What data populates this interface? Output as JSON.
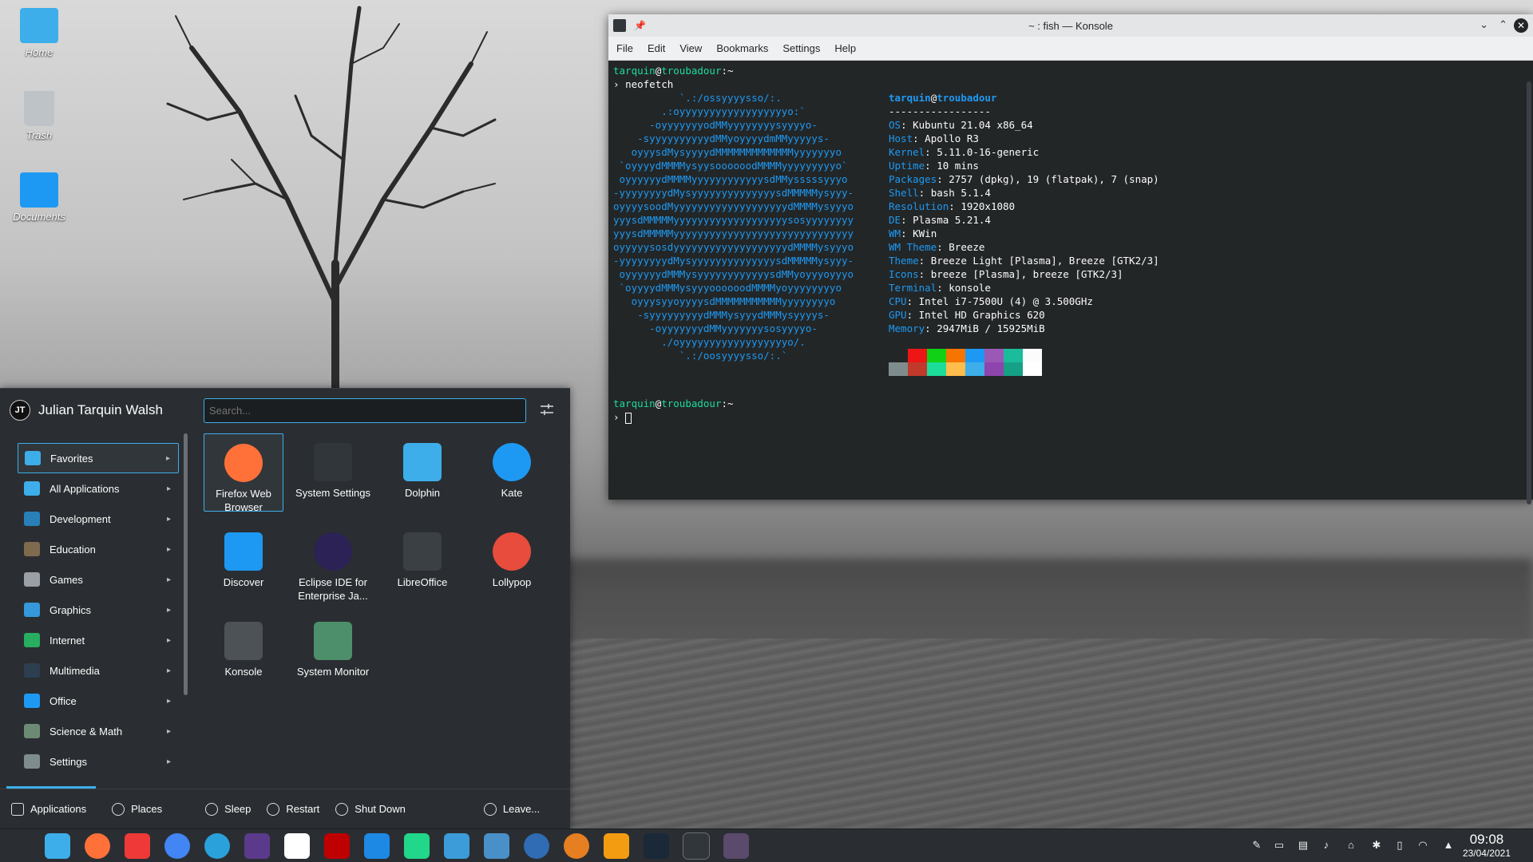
{
  "desktop": {
    "icons": [
      {
        "label": "Home"
      },
      {
        "label": "Trash"
      },
      {
        "label": "Documents"
      }
    ]
  },
  "konsole": {
    "title": "~ : fish — Konsole",
    "menu": [
      "File",
      "Edit",
      "View",
      "Bookmarks",
      "Settings",
      "Help"
    ],
    "prompt_user": "tarquin",
    "prompt_host": "troubadour",
    "prompt_path": "~",
    "command": "neofetch",
    "info_header_user": "tarquin",
    "info_header_host": "troubadour",
    "info_separator": "-----------------",
    "info": [
      {
        "key": "OS",
        "value": "Kubuntu 21.04 x86_64"
      },
      {
        "key": "Host",
        "value": "Apollo R3"
      },
      {
        "key": "Kernel",
        "value": "5.11.0-16-generic"
      },
      {
        "key": "Uptime",
        "value": "10 mins"
      },
      {
        "key": "Packages",
        "value": "2757 (dpkg), 19 (flatpak), 7 (snap)"
      },
      {
        "key": "Shell",
        "value": "bash 5.1.4"
      },
      {
        "key": "Resolution",
        "value": "1920x1080"
      },
      {
        "key": "DE",
        "value": "Plasma 5.21.4"
      },
      {
        "key": "WM",
        "value": "KWin"
      },
      {
        "key": "WM Theme",
        "value": "Breeze"
      },
      {
        "key": "Theme",
        "value": "Breeze Light [Plasma], Breeze [GTK2/3]"
      },
      {
        "key": "Icons",
        "value": "breeze [Plasma], breeze [GTK2/3]"
      },
      {
        "key": "Terminal",
        "value": "konsole"
      },
      {
        "key": "CPU",
        "value": "Intel i7-7500U (4) @ 3.500GHz"
      },
      {
        "key": "GPU",
        "value": "Intel HD Graphics 620"
      },
      {
        "key": "Memory",
        "value": "2947MiB / 15925MiB"
      }
    ],
    "palette_top": [
      "#232627",
      "#ed1515",
      "#11d116",
      "#f67400",
      "#1d99f3",
      "#9b59b6",
      "#1abc9c",
      "#fcfcfc"
    ],
    "palette_bottom": [
      "#7f8c8d",
      "#c0392b",
      "#1cdc9a",
      "#fdbc4b",
      "#3daee9",
      "#8e44ad",
      "#16a085",
      "#ffffff"
    ],
    "logo_lines": [
      "           `.:/ossyyyysso/:.",
      "        .:oyyyyyyyyyyyyyyyyyyo:`",
      "      -oyyyyyyyodMMyyyyyyyysyyyyo-",
      "    -syyyyyyyyyydMMyoyyyydmMMyyyyys-",
      "   oyyysdMysyyyydMMMMMMMMMMMMMyyyyyyyo",
      " `oyyyydMMMMysyysoooooodMMMMyyyyyyyyyo`",
      " oyyyyyydMMMMyyyyyyyyyyyysdMMysssssyyyo",
      "-yyyyyyyydMysyyyyyyyyyyyyyysdMMMMMysyyy-",
      "oyyyysoodMyyyyyyyyyyyyyyyyyyydMMMMysyyyo",
      "yyysdMMMMMyyyyyyyyyyyyyyyyyyysosyyyyyyyy",
      "yyysdMMMMMyyyyyyyyyyyyyyyyyyyyyyyyyyyyyy",
      "oyyyyysosdyyyyyyyyyyyyyyyyyyydMMMMysyyyo",
      "-yyyyyyyydMysyyyyyyyyyyyyyysdMMMMMysyyy-",
      " oyyyyyydMMMysyyyyyyyyyyyysdMMyoyyyoyyyo",
      " `oyyyydMMMysyyyoooooodMMMMyoyyyyyyyyo",
      "   oyyysyyoyyyysdMMMMMMMMMMMyyyyyyyyo",
      "    -syyyyyyyyydMMMysyyydMMMysyyyys-",
      "      -oyyyyyyydMMyyyyyyysosyyyyo-",
      "        ./oyyyyyyyyyyyyyyyyyyo/.",
      "           `.:/oosyyyysso/:.`"
    ]
  },
  "startmenu": {
    "user_initials": "JT",
    "user_name": "Julian Tarquin Walsh",
    "search_placeholder": "Search...",
    "categories": [
      {
        "label": "Favorites",
        "color": "#3daee9"
      },
      {
        "label": "All Applications",
        "color": "#3daee9"
      },
      {
        "label": "Development",
        "color": "#2980b9"
      },
      {
        "label": "Education",
        "color": "#7f6a4e"
      },
      {
        "label": "Games",
        "color": "#9aa0a6"
      },
      {
        "label": "Graphics",
        "color": "#3498db"
      },
      {
        "label": "Internet",
        "color": "#27ae60"
      },
      {
        "label": "Multimedia",
        "color": "#2c3e50"
      },
      {
        "label": "Office",
        "color": "#1d99f3"
      },
      {
        "label": "Science & Math",
        "color": "#6d8b74"
      },
      {
        "label": "Settings",
        "color": "#7f8c8d"
      }
    ],
    "apps": [
      {
        "label": "Firefox Web Browser",
        "color": "#ff7139"
      },
      {
        "label": "System Settings",
        "color": "#31363b"
      },
      {
        "label": "Dolphin",
        "color": "#3daee9"
      },
      {
        "label": "Kate",
        "color": "#1d99f3"
      },
      {
        "label": "Discover",
        "color": "#1d99f3"
      },
      {
        "label": "Eclipse IDE for Enterprise Ja...",
        "color": "#2c2255"
      },
      {
        "label": "LibreOffice",
        "color": "#3b4045"
      },
      {
        "label": "Lollypop",
        "color": "#e74c3c"
      },
      {
        "label": "Konsole",
        "color": "#4d5257"
      },
      {
        "label": "System Monitor",
        "color": "#4d8f6a"
      }
    ],
    "footer": {
      "applications": "Applications",
      "places": "Places",
      "sleep": "Sleep",
      "restart": "Restart",
      "shutdown": "Shut Down",
      "leave": "Leave..."
    }
  },
  "taskbar": {
    "apps": [
      {
        "name": "kickoff-launcher-icon",
        "color": "#2a2e32"
      },
      {
        "name": "dolphin-icon",
        "color": "#3daee9"
      },
      {
        "name": "firefox-icon",
        "color": "#ff7139"
      },
      {
        "name": "vivaldi-icon",
        "color": "#ef3939"
      },
      {
        "name": "chrome-icon",
        "color": "#4285f4"
      },
      {
        "name": "telegram-icon",
        "color": "#2aa1da"
      },
      {
        "name": "texstudio-icon",
        "color": "#5b3a8c"
      },
      {
        "name": "ghost-icon",
        "color": "#ffffff"
      },
      {
        "name": "filezilla-icon",
        "color": "#bf0000"
      },
      {
        "name": "vscode-icon",
        "color": "#1e88e5"
      },
      {
        "name": "pycharm-icon",
        "color": "#21d789"
      },
      {
        "name": "okular-icon",
        "color": "#3b9cd9"
      },
      {
        "name": "writer-icon",
        "color": "#4a90c8"
      },
      {
        "name": "blue-orb-icon",
        "color": "#2f6cb3"
      },
      {
        "name": "color-wheel-icon",
        "color": "#e67e22"
      },
      {
        "name": "flash-icon",
        "color": "#f39c12"
      },
      {
        "name": "steam-icon",
        "color": "#1b2838"
      },
      {
        "name": "konsole-icon",
        "color": "#31363b"
      },
      {
        "name": "java-ee-icon",
        "color": "#5b4a6b"
      }
    ],
    "time": "09:08",
    "date": "23/04/2021"
  }
}
